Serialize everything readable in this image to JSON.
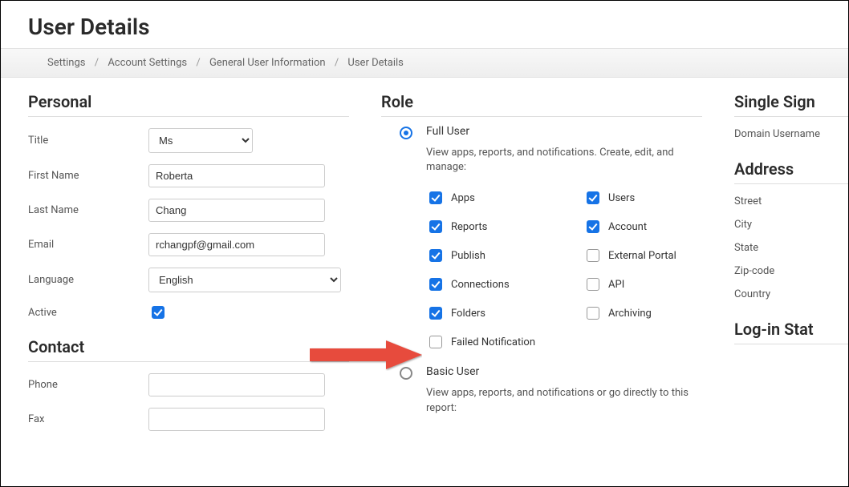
{
  "pageTitle": "User Details",
  "breadcrumb": [
    "Settings",
    "Account Settings",
    "General User Information",
    "User Details"
  ],
  "personal": {
    "heading": "Personal",
    "fields": {
      "titleLabel": "Title",
      "titleValue": "Ms",
      "firstNameLabel": "First Name",
      "firstNameValue": "Roberta",
      "lastNameLabel": "Last Name",
      "lastNameValue": "Chang",
      "emailLabel": "Email",
      "emailValue": "rchangpf@gmail.com",
      "languageLabel": "Language",
      "languageValue": "English",
      "activeLabel": "Active",
      "activeChecked": true
    }
  },
  "contact": {
    "heading": "Contact",
    "phoneLabel": "Phone",
    "phoneValue": "",
    "faxLabel": "Fax",
    "faxValue": ""
  },
  "role": {
    "heading": "Role",
    "full": {
      "label": "Full User",
      "selected": true,
      "desc": "View apps, reports, and notifications. Create, edit, and manage:",
      "permsLeft": [
        {
          "label": "Apps",
          "checked": true
        },
        {
          "label": "Reports",
          "checked": true
        },
        {
          "label": "Publish",
          "checked": true
        },
        {
          "label": "Connections",
          "checked": true
        },
        {
          "label": "Folders",
          "checked": true
        },
        {
          "label": "Failed Notification",
          "checked": false
        }
      ],
      "permsRight": [
        {
          "label": "Users",
          "checked": true
        },
        {
          "label": "Account",
          "checked": true
        },
        {
          "label": "External Portal",
          "checked": false
        },
        {
          "label": "API",
          "checked": false
        },
        {
          "label": "Archiving",
          "checked": false
        }
      ]
    },
    "basic": {
      "label": "Basic User",
      "selected": false,
      "desc": "View apps, reports, and notifications or go directly to this report:"
    }
  },
  "sso": {
    "heading": "Single Sign",
    "domainUserLabel": "Domain Username"
  },
  "address": {
    "heading": "Address",
    "streetLabel": "Street",
    "cityLabel": "City",
    "stateLabel": "State",
    "zipLabel": "Zip-code",
    "countryLabel": "Country"
  },
  "login": {
    "heading": "Log-in Stat"
  }
}
